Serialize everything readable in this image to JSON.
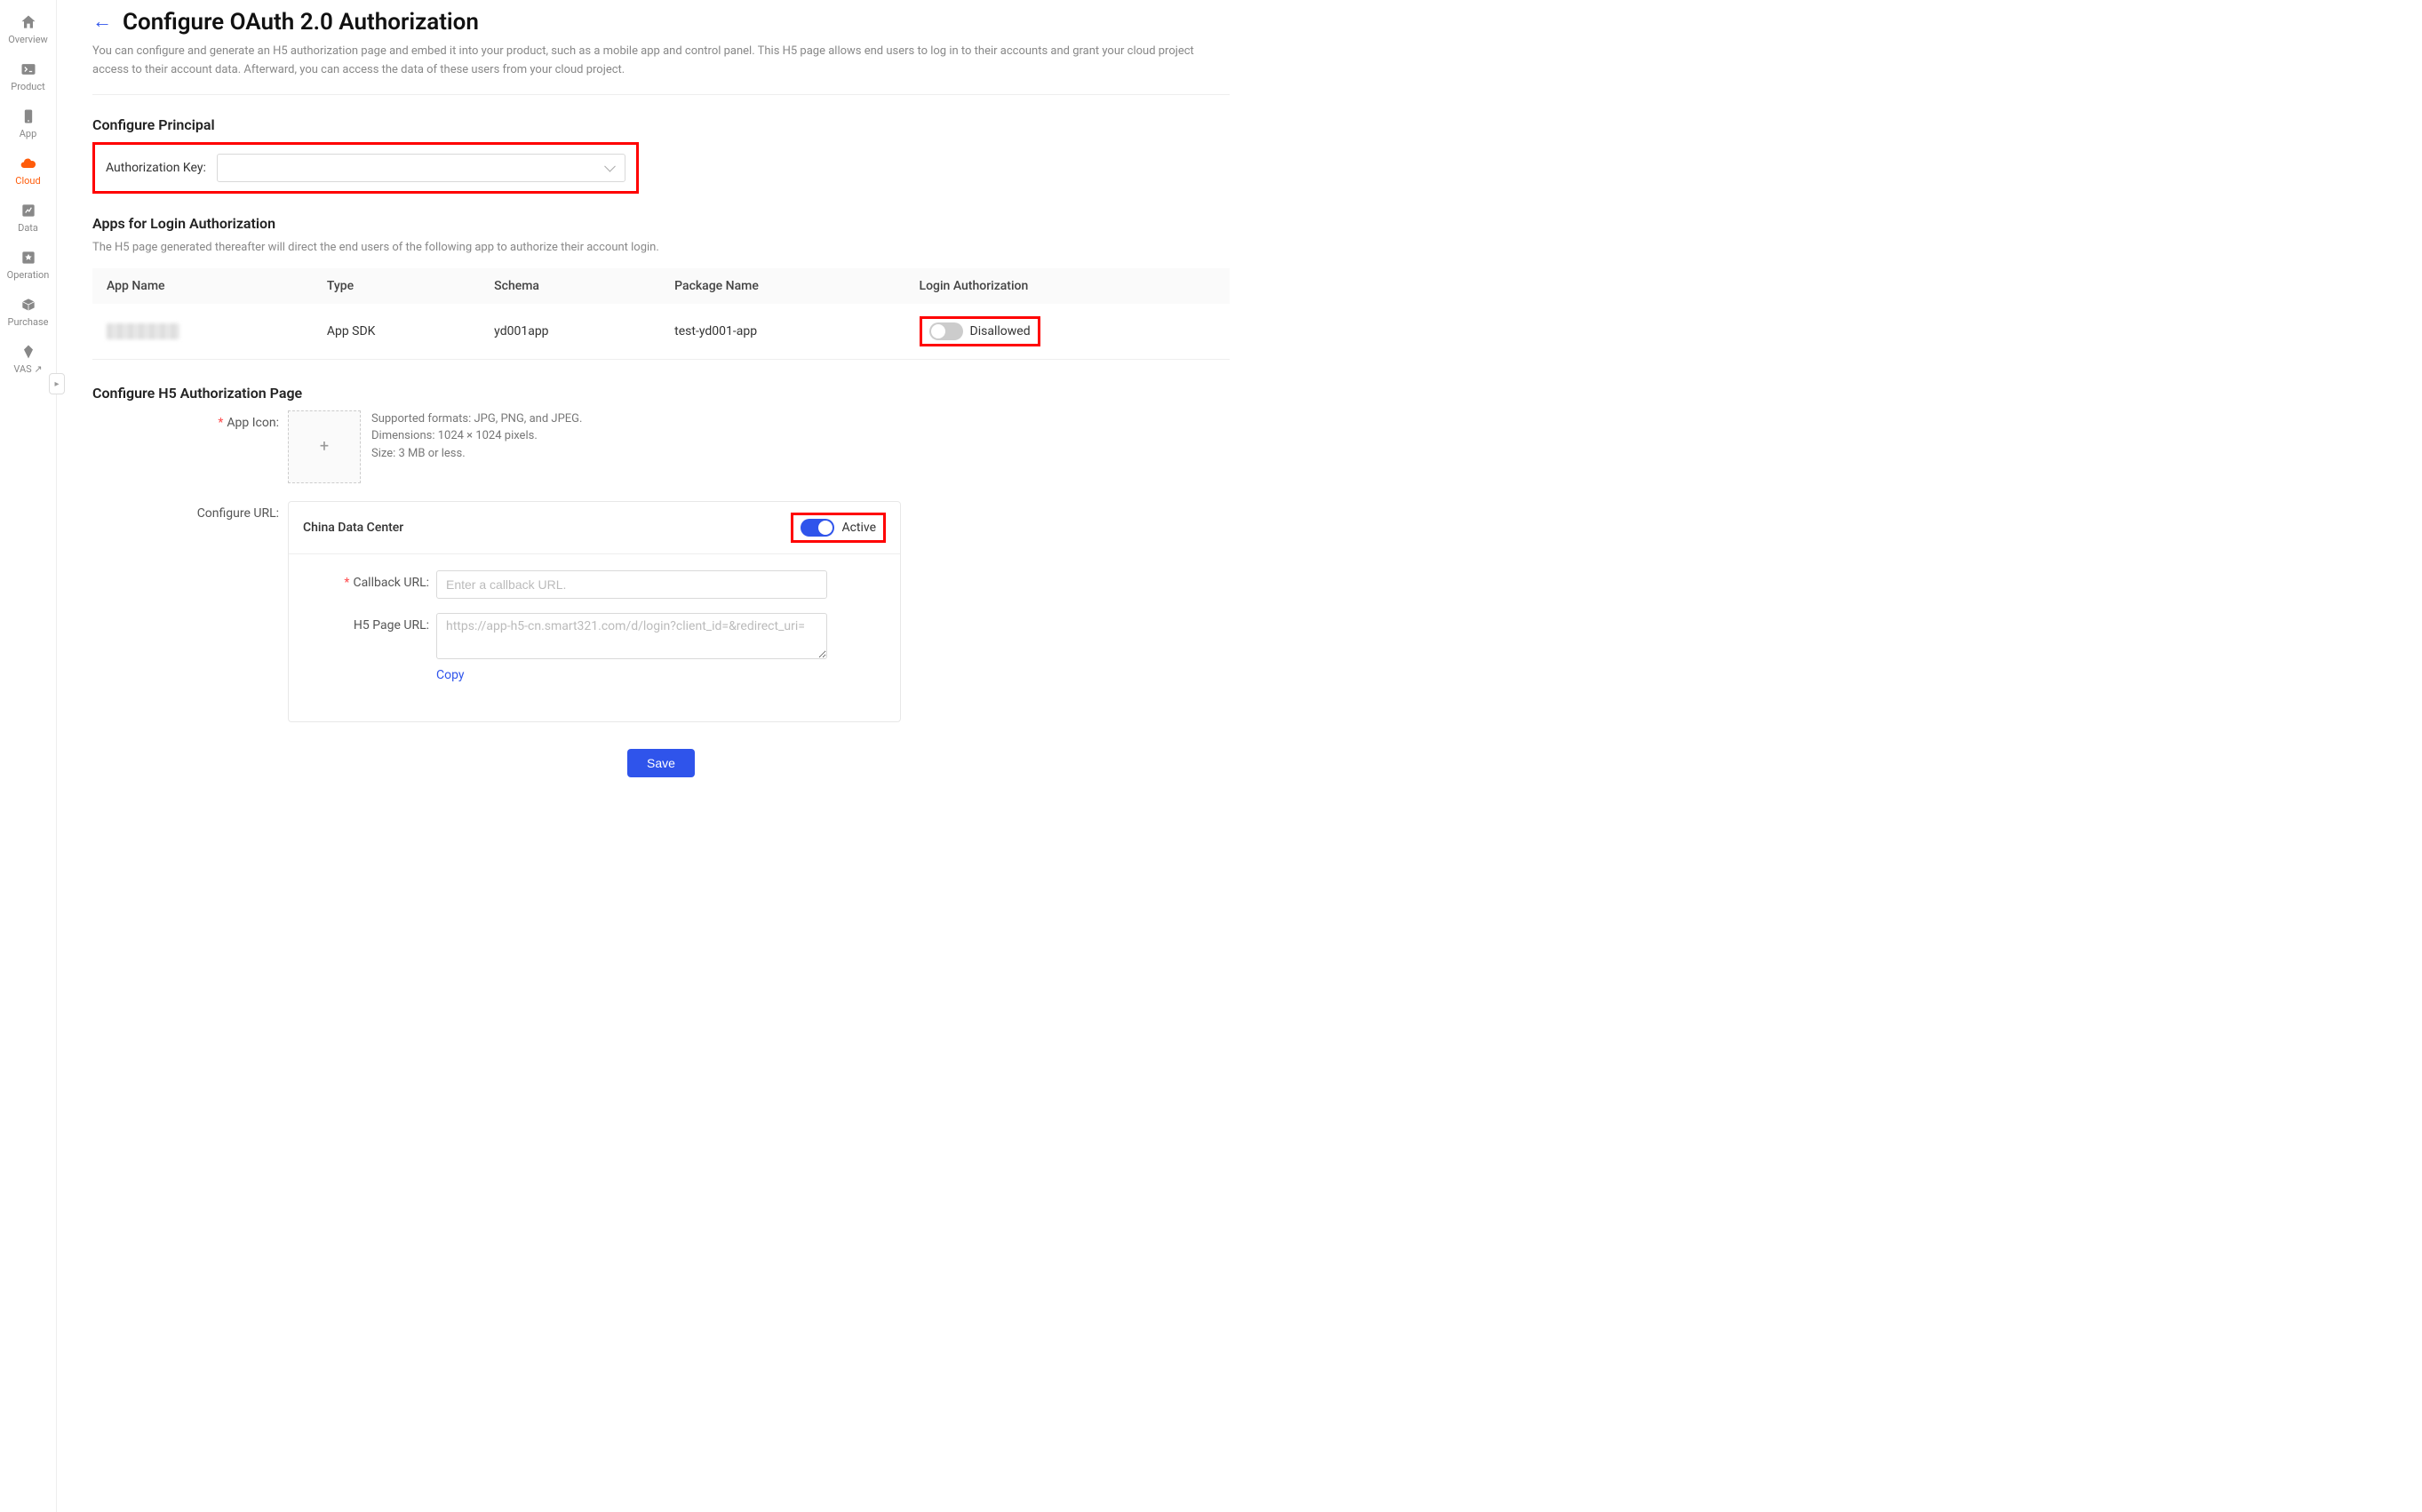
{
  "sidebar": {
    "items": [
      {
        "label": "Overview",
        "icon": "home"
      },
      {
        "label": "Product",
        "icon": "terminal"
      },
      {
        "label": "App",
        "icon": "phone"
      },
      {
        "label": "Cloud",
        "icon": "cloud",
        "active": true
      },
      {
        "label": "Data",
        "icon": "chart"
      },
      {
        "label": "Operation",
        "icon": "star"
      },
      {
        "label": "Purchase",
        "icon": "box"
      },
      {
        "label": "VAS ↗",
        "icon": "diamond"
      }
    ]
  },
  "header": {
    "title": "Configure OAuth 2.0 Authorization",
    "description": "You can configure and generate an H5 authorization page and embed it into your product, such as a mobile app and control panel. This H5 page allows end users to log in to their accounts and grant your cloud project access to their account data. Afterward, you can access the data of these users from your cloud project."
  },
  "principal": {
    "section_title": "Configure Principal",
    "auth_key_label": "Authorization Key:",
    "auth_key_value": ""
  },
  "apps_section": {
    "title": "Apps for Login Authorization",
    "subtext": "The H5 page generated thereafter will direct the end users of the following app to authorize their account login.",
    "columns": {
      "app_name": "App Name",
      "type": "Type",
      "schema": "Schema",
      "package_name": "Package Name",
      "login_auth": "Login Authorization"
    },
    "rows": [
      {
        "app_name": "(redacted)",
        "type": "App SDK",
        "schema": "yd001app",
        "package_name": "test-yd001-app",
        "login_auth_state": "off",
        "login_auth_label": "Disallowed"
      }
    ]
  },
  "h5_section": {
    "title": "Configure H5 Authorization Page",
    "app_icon_label": "App Icon:",
    "app_icon_hints": {
      "l1": "Supported formats: JPG, PNG, and JPEG.",
      "l2": "Dimensions: 1024 × 1024 pixels.",
      "l3": "Size: 3 MB or less."
    },
    "configure_url_label": "Configure URL:",
    "card": {
      "title": "China Data Center",
      "active_state": "on",
      "active_label": "Active",
      "callback_label": "Callback URL:",
      "callback_placeholder": "Enter a callback URL.",
      "callback_value": "",
      "h5_label": "H5 Page URL:",
      "h5_value": "https://app-h5-cn.smart321.com/d/login?client_id=&redirect_uri=",
      "copy_label": "Copy"
    }
  },
  "footer": {
    "save_label": "Save"
  }
}
